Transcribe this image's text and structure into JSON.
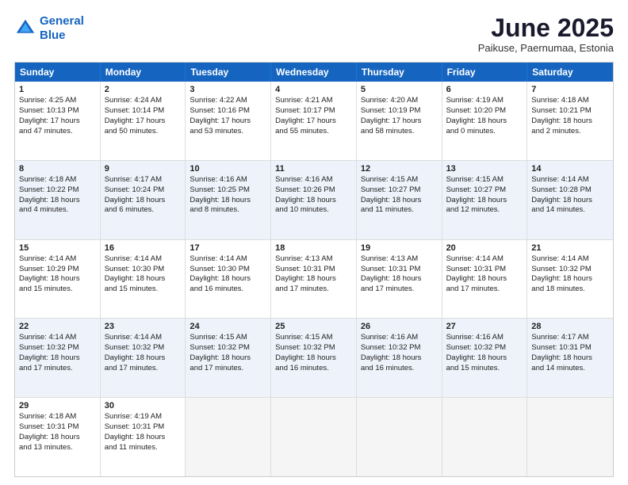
{
  "logo": {
    "line1": "General",
    "line2": "Blue"
  },
  "title": "June 2025",
  "location": "Paikuse, Paernumaa, Estonia",
  "headers": [
    "Sunday",
    "Monday",
    "Tuesday",
    "Wednesday",
    "Thursday",
    "Friday",
    "Saturday"
  ],
  "rows": [
    {
      "alt": false,
      "cells": [
        {
          "day": "1",
          "lines": [
            "Sunrise: 4:25 AM",
            "Sunset: 10:13 PM",
            "Daylight: 17 hours",
            "and 47 minutes."
          ]
        },
        {
          "day": "2",
          "lines": [
            "Sunrise: 4:24 AM",
            "Sunset: 10:14 PM",
            "Daylight: 17 hours",
            "and 50 minutes."
          ]
        },
        {
          "day": "3",
          "lines": [
            "Sunrise: 4:22 AM",
            "Sunset: 10:16 PM",
            "Daylight: 17 hours",
            "and 53 minutes."
          ]
        },
        {
          "day": "4",
          "lines": [
            "Sunrise: 4:21 AM",
            "Sunset: 10:17 PM",
            "Daylight: 17 hours",
            "and 55 minutes."
          ]
        },
        {
          "day": "5",
          "lines": [
            "Sunrise: 4:20 AM",
            "Sunset: 10:19 PM",
            "Daylight: 17 hours",
            "and 58 minutes."
          ]
        },
        {
          "day": "6",
          "lines": [
            "Sunrise: 4:19 AM",
            "Sunset: 10:20 PM",
            "Daylight: 18 hours",
            "and 0 minutes."
          ]
        },
        {
          "day": "7",
          "lines": [
            "Sunrise: 4:18 AM",
            "Sunset: 10:21 PM",
            "Daylight: 18 hours",
            "and 2 minutes."
          ]
        }
      ]
    },
    {
      "alt": true,
      "cells": [
        {
          "day": "8",
          "lines": [
            "Sunrise: 4:18 AM",
            "Sunset: 10:22 PM",
            "Daylight: 18 hours",
            "and 4 minutes."
          ]
        },
        {
          "day": "9",
          "lines": [
            "Sunrise: 4:17 AM",
            "Sunset: 10:24 PM",
            "Daylight: 18 hours",
            "and 6 minutes."
          ]
        },
        {
          "day": "10",
          "lines": [
            "Sunrise: 4:16 AM",
            "Sunset: 10:25 PM",
            "Daylight: 18 hours",
            "and 8 minutes."
          ]
        },
        {
          "day": "11",
          "lines": [
            "Sunrise: 4:16 AM",
            "Sunset: 10:26 PM",
            "Daylight: 18 hours",
            "and 10 minutes."
          ]
        },
        {
          "day": "12",
          "lines": [
            "Sunrise: 4:15 AM",
            "Sunset: 10:27 PM",
            "Daylight: 18 hours",
            "and 11 minutes."
          ]
        },
        {
          "day": "13",
          "lines": [
            "Sunrise: 4:15 AM",
            "Sunset: 10:27 PM",
            "Daylight: 18 hours",
            "and 12 minutes."
          ]
        },
        {
          "day": "14",
          "lines": [
            "Sunrise: 4:14 AM",
            "Sunset: 10:28 PM",
            "Daylight: 18 hours",
            "and 14 minutes."
          ]
        }
      ]
    },
    {
      "alt": false,
      "cells": [
        {
          "day": "15",
          "lines": [
            "Sunrise: 4:14 AM",
            "Sunset: 10:29 PM",
            "Daylight: 18 hours",
            "and 15 minutes."
          ]
        },
        {
          "day": "16",
          "lines": [
            "Sunrise: 4:14 AM",
            "Sunset: 10:30 PM",
            "Daylight: 18 hours",
            "and 15 minutes."
          ]
        },
        {
          "day": "17",
          "lines": [
            "Sunrise: 4:14 AM",
            "Sunset: 10:30 PM",
            "Daylight: 18 hours",
            "and 16 minutes."
          ]
        },
        {
          "day": "18",
          "lines": [
            "Sunrise: 4:13 AM",
            "Sunset: 10:31 PM",
            "Daylight: 18 hours",
            "and 17 minutes."
          ]
        },
        {
          "day": "19",
          "lines": [
            "Sunrise: 4:13 AM",
            "Sunset: 10:31 PM",
            "Daylight: 18 hours",
            "and 17 minutes."
          ]
        },
        {
          "day": "20",
          "lines": [
            "Sunrise: 4:14 AM",
            "Sunset: 10:31 PM",
            "Daylight: 18 hours",
            "and 17 minutes."
          ]
        },
        {
          "day": "21",
          "lines": [
            "Sunrise: 4:14 AM",
            "Sunset: 10:32 PM",
            "Daylight: 18 hours",
            "and 18 minutes."
          ]
        }
      ]
    },
    {
      "alt": true,
      "cells": [
        {
          "day": "22",
          "lines": [
            "Sunrise: 4:14 AM",
            "Sunset: 10:32 PM",
            "Daylight: 18 hours",
            "and 17 minutes."
          ]
        },
        {
          "day": "23",
          "lines": [
            "Sunrise: 4:14 AM",
            "Sunset: 10:32 PM",
            "Daylight: 18 hours",
            "and 17 minutes."
          ]
        },
        {
          "day": "24",
          "lines": [
            "Sunrise: 4:15 AM",
            "Sunset: 10:32 PM",
            "Daylight: 18 hours",
            "and 17 minutes."
          ]
        },
        {
          "day": "25",
          "lines": [
            "Sunrise: 4:15 AM",
            "Sunset: 10:32 PM",
            "Daylight: 18 hours",
            "and 16 minutes."
          ]
        },
        {
          "day": "26",
          "lines": [
            "Sunrise: 4:16 AM",
            "Sunset: 10:32 PM",
            "Daylight: 18 hours",
            "and 16 minutes."
          ]
        },
        {
          "day": "27",
          "lines": [
            "Sunrise: 4:16 AM",
            "Sunset: 10:32 PM",
            "Daylight: 18 hours",
            "and 15 minutes."
          ]
        },
        {
          "day": "28",
          "lines": [
            "Sunrise: 4:17 AM",
            "Sunset: 10:31 PM",
            "Daylight: 18 hours",
            "and 14 minutes."
          ]
        }
      ]
    },
    {
      "alt": false,
      "cells": [
        {
          "day": "29",
          "lines": [
            "Sunrise: 4:18 AM",
            "Sunset: 10:31 PM",
            "Daylight: 18 hours",
            "and 13 minutes."
          ]
        },
        {
          "day": "30",
          "lines": [
            "Sunrise: 4:19 AM",
            "Sunset: 10:31 PM",
            "Daylight: 18 hours",
            "and 11 minutes."
          ]
        },
        {
          "day": "",
          "lines": [],
          "empty": true
        },
        {
          "day": "",
          "lines": [],
          "empty": true
        },
        {
          "day": "",
          "lines": [],
          "empty": true
        },
        {
          "day": "",
          "lines": [],
          "empty": true
        },
        {
          "day": "",
          "lines": [],
          "empty": true
        }
      ]
    }
  ]
}
